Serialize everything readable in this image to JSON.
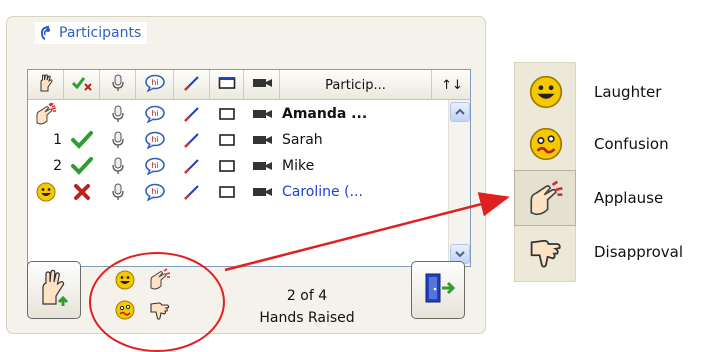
{
  "panel": {
    "title": "Participants"
  },
  "list": {
    "columns": [
      {
        "key": "raise",
        "icon": "raised-hand-icon"
      },
      {
        "key": "permission",
        "icon": "check-x-icon"
      },
      {
        "key": "microphone",
        "icon": "microphone-icon"
      },
      {
        "key": "chat",
        "icon": "chat-bubble-icon"
      },
      {
        "key": "draw",
        "icon": "pencil-icon"
      },
      {
        "key": "screen",
        "icon": "screen-icon"
      },
      {
        "key": "camera",
        "icon": "camera-icon"
      },
      {
        "key": "name",
        "label": "Particip..."
      },
      {
        "key": "sort",
        "label": "↑↓"
      }
    ],
    "rows": [
      {
        "status_icon": "applause-icon",
        "order": "",
        "permission": "none",
        "name": "Amanda ...",
        "style": "bold"
      },
      {
        "status_icon": "",
        "order": "1",
        "permission": "granted",
        "name": "Sarah",
        "style": "normal"
      },
      {
        "status_icon": "",
        "order": "2",
        "permission": "granted",
        "name": "Mike",
        "style": "normal"
      },
      {
        "status_icon": "laughter-icon",
        "order": "",
        "permission": "denied",
        "name": "Caroline (...",
        "style": "blue"
      }
    ]
  },
  "status": {
    "count": "2 of 4",
    "label": "Hands Raised"
  },
  "emotions": [
    {
      "icon": "laughter-icon",
      "label": "Laughter"
    },
    {
      "icon": "confusion-icon",
      "label": "Confusion"
    },
    {
      "icon": "applause-icon",
      "label": "Applause",
      "highlighted": true
    },
    {
      "icon": "disapproval-icon",
      "label": "Disapproval"
    }
  ],
  "colors": {
    "accent_blue": "#2d5fc3",
    "callout_red": "#e02020",
    "granted_green": "#2e9e2e",
    "denied_red": "#c02020",
    "smiley_yellow": "#f5c800"
  }
}
